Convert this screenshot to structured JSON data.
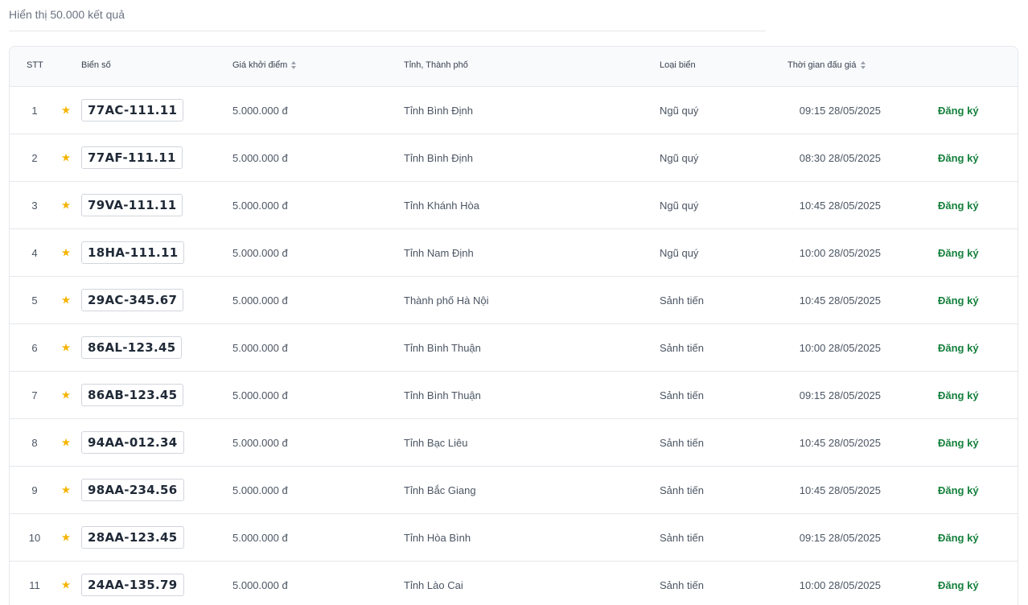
{
  "summary": {
    "result_count_text": "Hiển thị 50.000 kết quả"
  },
  "table": {
    "headers": {
      "stt": "STT",
      "plate": "Biển số",
      "price": "Giá khởi điểm",
      "province": "Tỉnh, Thành phố",
      "type": "Loại biển",
      "time": "Thời gian đấu giá"
    },
    "rows": [
      {
        "stt": "1",
        "plate": "77AC-111.11",
        "price": "5.000.000 đ",
        "province": "Tỉnh Bình Định",
        "type": "Ngũ quý",
        "time": "09:15 28/05/2025",
        "action": "Đăng ký"
      },
      {
        "stt": "2",
        "plate": "77AF-111.11",
        "price": "5.000.000 đ",
        "province": "Tỉnh Bình Định",
        "type": "Ngũ quý",
        "time": "08:30 28/05/2025",
        "action": "Đăng ký"
      },
      {
        "stt": "3",
        "plate": "79VA-111.11",
        "price": "5.000.000 đ",
        "province": "Tỉnh Khánh Hòa",
        "type": "Ngũ quý",
        "time": "10:45 28/05/2025",
        "action": "Đăng ký"
      },
      {
        "stt": "4",
        "plate": "18HA-111.11",
        "price": "5.000.000 đ",
        "province": "Tỉnh Nam Định",
        "type": "Ngũ quý",
        "time": "10:00 28/05/2025",
        "action": "Đăng ký"
      },
      {
        "stt": "5",
        "plate": "29AC-345.67",
        "price": "5.000.000 đ",
        "province": "Thành phố Hà Nội",
        "type": "Sảnh tiến",
        "time": "10:45 28/05/2025",
        "action": "Đăng ký"
      },
      {
        "stt": "6",
        "plate": "86AL-123.45",
        "price": "5.000.000 đ",
        "province": "Tỉnh Bình Thuận",
        "type": "Sảnh tiến",
        "time": "10:00 28/05/2025",
        "action": "Đăng ký"
      },
      {
        "stt": "7",
        "plate": "86AB-123.45",
        "price": "5.000.000 đ",
        "province": "Tỉnh Bình Thuận",
        "type": "Sảnh tiến",
        "time": "09:15 28/05/2025",
        "action": "Đăng ký"
      },
      {
        "stt": "8",
        "plate": "94AA-012.34",
        "price": "5.000.000 đ",
        "province": "Tỉnh Bạc Liêu",
        "type": "Sảnh tiến",
        "time": "10:45 28/05/2025",
        "action": "Đăng ký"
      },
      {
        "stt": "9",
        "plate": "98AA-234.56",
        "price": "5.000.000 đ",
        "province": "Tỉnh Bắc Giang",
        "type": "Sảnh tiến",
        "time": "10:45 28/05/2025",
        "action": "Đăng ký"
      },
      {
        "stt": "10",
        "plate": "28AA-123.45",
        "price": "5.000.000 đ",
        "province": "Tỉnh Hòa Bình",
        "type": "Sảnh tiến",
        "time": "09:15 28/05/2025",
        "action": "Đăng ký"
      },
      {
        "stt": "11",
        "plate": "24AA-135.79",
        "price": "5.000.000 đ",
        "province": "Tỉnh Lào Cai",
        "type": "Sảnh tiến",
        "time": "10:00 28/05/2025",
        "action": "Đăng ký"
      }
    ]
  },
  "colors": {
    "accent_green": "#15803d",
    "star_yellow": "#f5b400"
  },
  "icons": {
    "favorite": "star-icon",
    "sort": "sort-icon"
  }
}
